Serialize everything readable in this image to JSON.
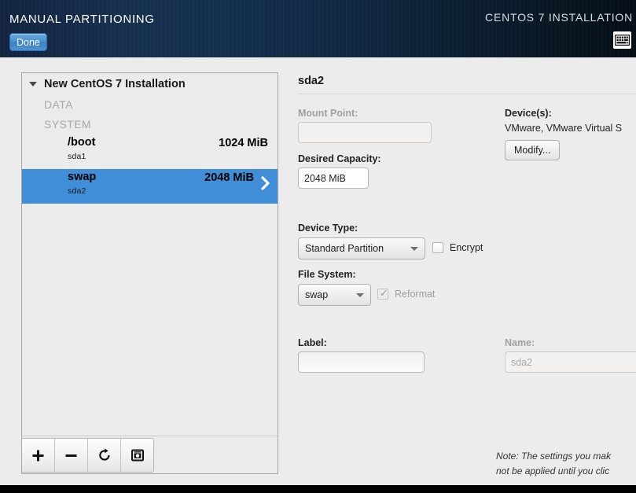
{
  "header": {
    "title": "MANUAL PARTITIONING",
    "right_title": "CENTOS 7 INSTALLATION",
    "done_label": "Done",
    "keyboard_icon": "keyboard-icon",
    "bg_color": "#12243f",
    "accent_color": "#4d92d0"
  },
  "partition_panel": {
    "group": {
      "title": "New CentOS 7 Installation",
      "expanded": true
    },
    "sections": [
      {
        "label": "DATA",
        "rows": []
      },
      {
        "label": "SYSTEM",
        "rows": [
          {
            "name": "/boot",
            "device": "sda1",
            "size": "1024 MiB",
            "selected": false
          },
          {
            "name": "swap",
            "device": "sda2",
            "size": "2048 MiB",
            "selected": true
          }
        ]
      }
    ],
    "selected_color": "#3f8ed7",
    "toolbar": [
      {
        "icon": "plus-icon",
        "label": "+"
      },
      {
        "icon": "minus-icon",
        "label": "−"
      },
      {
        "icon": "refresh-icon",
        "label": "↻"
      },
      {
        "icon": "storage-config-icon",
        "label": ""
      }
    ]
  },
  "details": {
    "device_title": "sda2",
    "mount_point": {
      "label": "Mount Point:",
      "value": "",
      "disabled": true
    },
    "desired_capacity": {
      "label": "Desired Capacity:",
      "value": "2048 MiB",
      "disabled": false
    },
    "device_type": {
      "label": "Device Type:",
      "value": "Standard Partition"
    },
    "encrypt": {
      "label": "Encrypt",
      "checked": false,
      "disabled": false
    },
    "file_system": {
      "label": "File System:",
      "value": "swap"
    },
    "reformat": {
      "label": "Reformat",
      "checked": true,
      "disabled": true
    },
    "label_field": {
      "label": "Label:",
      "value": "",
      "disabled": false
    },
    "name_field": {
      "label": "Name:",
      "value": "sda2",
      "disabled": true
    },
    "devices": {
      "label": "Device(s):",
      "value": "VMware, VMware Virtual S",
      "modify_label": "Modify..."
    },
    "note_line1": "Note:  The settings you mak",
    "note_line2": "not be applied until you clic"
  }
}
